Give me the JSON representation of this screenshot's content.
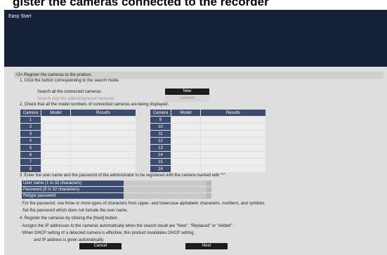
{
  "caption": "gister the cameras connected to the recorder",
  "window_title": "Easy Start",
  "section_heading": "<2> Register the cameras to the product.",
  "step1": {
    "heading": "1. Click the button corresponding to the search mode.",
    "search_all_label": "Search all the connected cameras",
    "search_added_label": "Search only the added/replaced cameras",
    "new_button": "New",
    "addition_button": "Addition"
  },
  "step2": {
    "heading": "2. Check that all the model numbers of connected cameras are being displayed.",
    "columns": [
      "Camera",
      "Model",
      "Results"
    ],
    "left_cameras": [
      "1",
      "2",
      "3",
      "4",
      "5",
      "6",
      "7",
      "8"
    ],
    "right_cameras": [
      "9",
      "10",
      "11",
      "12",
      "13",
      "14",
      "15",
      "16"
    ]
  },
  "step3": {
    "heading": "3. Enter the user name and the password of the administrator to be registered with the camera marked with \"*\".",
    "username_label": "User name (1 to 32 characters)",
    "password_label": "Password (8 to 32 characters)",
    "retype_label": "Retype password",
    "note1": "· For the password, use three or more types of characters from upper- and lowercase alphabetic characters, numbers, and symbols.",
    "note2": "· Set the password which does not include the user name."
  },
  "step4": {
    "heading": "4. Register the cameras by clicking the [Next] button.",
    "note1": "· Assigns the IP addresses to the cameras automatically when the search result are \"New\", \"Replaced\" or \"Added\".",
    "note2": "· When DHCP setting of a detected camera is effective, this product invalidates DHCP setting,",
    "note3": "and IP address is given automatically."
  },
  "buttons": {
    "cancel": "Cancel",
    "next": "Next"
  },
  "colors": {
    "titlebar": "#17223a",
    "header_cell": "#3c4c6e",
    "button": "#1c1c1c"
  }
}
